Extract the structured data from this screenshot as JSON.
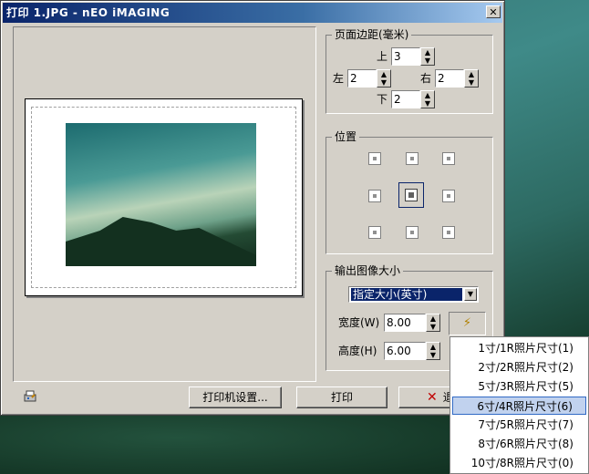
{
  "window": {
    "title": "打印 1.JPG - nEO iMAGING",
    "close_label": "✕"
  },
  "margins": {
    "group_label": "页面边距(毫米)",
    "top_label": "上",
    "top_value": "3",
    "left_label": "左",
    "left_value": "2",
    "right_label": "右",
    "right_value": "2",
    "bottom_label": "下",
    "bottom_value": "2"
  },
  "position": {
    "group_label": "位置",
    "selected": "center"
  },
  "output_size": {
    "group_label": "输出图像大小",
    "mode_value": "指定大小(英寸)",
    "width_label": "宽度(W)",
    "width_value": "8.00",
    "height_label": "高度(H)",
    "height_value": "6.00"
  },
  "preset_menu": {
    "items": [
      "1寸/1R照片尺寸(1)",
      "2寸/2R照片尺寸(2)",
      "5寸/3R照片尺寸(5)",
      "6寸/4R照片尺寸(6)",
      "7寸/5R照片尺寸(7)",
      "8寸/6R照片尺寸(8)",
      "10寸/8R照片尺寸(0)"
    ],
    "highlighted_index": 3
  },
  "buttons": {
    "printer_setup": "打印机设置...",
    "print": "打印",
    "cancel": "退"
  },
  "colors": {
    "titlebar_start": "#0a246a",
    "titlebar_end": "#a6caf0",
    "dialog_bg": "#d4d0c8",
    "highlight": "#c1d2ee"
  }
}
